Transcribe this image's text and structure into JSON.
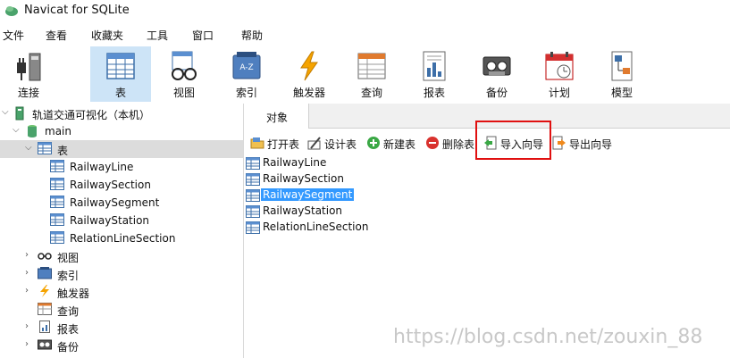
{
  "window": {
    "title": "Navicat for SQLite",
    "logo_icon": "navicat-logo-icon"
  },
  "menu": [
    "文件",
    "查看",
    "收藏夹",
    "工具",
    "窗口",
    "帮助"
  ],
  "toolbar": [
    {
      "label": "连接",
      "icon": "plug-icon"
    },
    {
      "label": "表",
      "icon": "table-icon",
      "active": true
    },
    {
      "label": "视图",
      "icon": "glasses-icon"
    },
    {
      "label": "索引",
      "icon": "index-icon"
    },
    {
      "label": "触发器",
      "icon": "lightning-icon"
    },
    {
      "label": "查询",
      "icon": "query-icon"
    },
    {
      "label": "报表",
      "icon": "report-icon"
    },
    {
      "label": "备份",
      "icon": "tape-icon"
    },
    {
      "label": "计划",
      "icon": "calendar-icon"
    },
    {
      "label": "模型",
      "icon": "model-icon"
    }
  ],
  "tree": {
    "connection": "轨道交通可视化（本机）",
    "database": "main",
    "tables_label": "表",
    "tables": [
      "RailwayLine",
      "RailwaySection",
      "RailwaySegment",
      "RailwayStation",
      "RelationLineSection"
    ],
    "groups": [
      "视图",
      "索引",
      "触发器",
      "查询",
      "报表",
      "备份"
    ]
  },
  "object_tab": "对象",
  "object_toolbar": [
    "打开表",
    "设计表",
    "新建表",
    "删除表",
    "导入向导",
    "导出向导"
  ],
  "object_list": [
    "RailwayLine",
    "RailwaySection",
    "RailwaySegment",
    "RailwayStation",
    "RelationLineSection"
  ],
  "selected_object": "RailwaySegment",
  "watermark": "https://blog.csdn.net/zouxin_88",
  "colors": {
    "accent": "#3399ff",
    "highlight_box": "#e01010",
    "active_tool": "#cde4f7"
  }
}
